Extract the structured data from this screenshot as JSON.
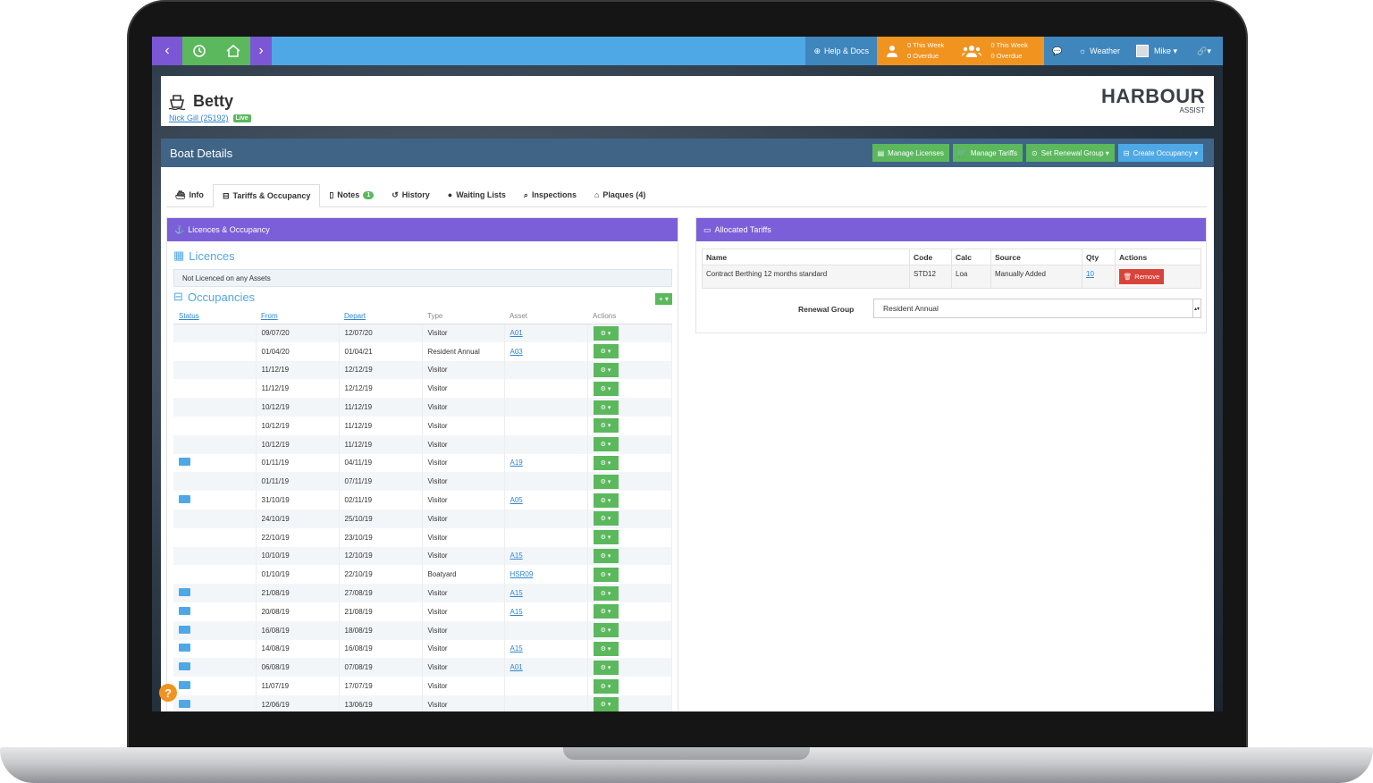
{
  "topbar": {
    "help_label": "Help & Docs",
    "stats_a": {
      "week": "0 This Week",
      "overdue": "0 Overdue"
    },
    "stats_b": {
      "week": "0 This Week",
      "overdue": "0 Overdue"
    },
    "weather_label": "Weather",
    "user_label": "Mike ▾"
  },
  "header": {
    "boat_name": "Betty",
    "owner_link": "Nick Gill (25192)",
    "status_badge": "Live",
    "logo_main": "HARBOUR",
    "logo_sub": "ASSIST"
  },
  "panel": {
    "title": "Boat Details",
    "buttons": {
      "manage_licenses": "Manage Licenses",
      "manage_tariffs": "Manage Tariffs",
      "set_renewal": "Set Renewal Group ▾",
      "create_occupancy": "Create Occupancy ▾"
    }
  },
  "tabs": {
    "info": "Info",
    "tariffs": "Tariffs & Occupancy",
    "notes": "Notes",
    "notes_count": "1",
    "history": "History",
    "waiting": "Waiting Lists",
    "inspections": "Inspections",
    "plaques": "Plaques (4)"
  },
  "left": {
    "card_title": "Licences & Occupancy",
    "licences_title": "Licences",
    "not_licenced": "Not Licenced on any Assets",
    "occupancies_title": "Occupancies",
    "columns": [
      "Status",
      "From",
      "Depart",
      "Type",
      "Asset",
      "Actions"
    ],
    "rows": [
      {
        "from": "09/07/20",
        "depart": "12/07/20",
        "type": "Visitor",
        "asset": "A01",
        "icon": false
      },
      {
        "from": "01/04/20",
        "depart": "01/04/21",
        "type": "Resident Annual",
        "asset": "A03",
        "icon": false
      },
      {
        "from": "11/12/19",
        "depart": "12/12/19",
        "type": "Visitor",
        "asset": "",
        "icon": false
      },
      {
        "from": "11/12/19",
        "depart": "12/12/19",
        "type": "Visitor",
        "asset": "",
        "icon": false
      },
      {
        "from": "10/12/19",
        "depart": "11/12/19",
        "type": "Visitor",
        "asset": "",
        "icon": false
      },
      {
        "from": "10/12/19",
        "depart": "11/12/19",
        "type": "Visitor",
        "asset": "",
        "icon": false
      },
      {
        "from": "10/12/19",
        "depart": "11/12/19",
        "type": "Visitor",
        "asset": "",
        "icon": false
      },
      {
        "from": "01/11/19",
        "depart": "04/11/19",
        "type": "Visitor",
        "asset": "A19",
        "icon": true
      },
      {
        "from": "01/11/19",
        "depart": "07/11/19",
        "type": "Visitor",
        "asset": "",
        "icon": false
      },
      {
        "from": "31/10/19",
        "depart": "02/11/19",
        "type": "Visitor",
        "asset": "A05",
        "icon": true
      },
      {
        "from": "24/10/19",
        "depart": "25/10/19",
        "type": "Visitor",
        "asset": "",
        "icon": false
      },
      {
        "from": "22/10/19",
        "depart": "23/10/19",
        "type": "Visitor",
        "asset": "",
        "icon": false
      },
      {
        "from": "10/10/19",
        "depart": "12/10/19",
        "type": "Visitor",
        "asset": "A15",
        "icon": false
      },
      {
        "from": "01/10/19",
        "depart": "22/10/19",
        "type": "Boatyard",
        "asset": "HSR09",
        "icon": false
      },
      {
        "from": "21/08/19",
        "depart": "27/08/19",
        "type": "Visitor",
        "asset": "A15",
        "icon": true
      },
      {
        "from": "20/08/19",
        "depart": "21/08/19",
        "type": "Visitor",
        "asset": "A15",
        "icon": true
      },
      {
        "from": "16/08/19",
        "depart": "18/08/19",
        "type": "Visitor",
        "asset": "",
        "icon": true
      },
      {
        "from": "14/08/19",
        "depart": "16/08/19",
        "type": "Visitor",
        "asset": "A15",
        "icon": true
      },
      {
        "from": "06/08/19",
        "depart": "07/08/19",
        "type": "Visitor",
        "asset": "A01",
        "icon": true
      },
      {
        "from": "11/07/19",
        "depart": "17/07/19",
        "type": "Visitor",
        "asset": "",
        "icon": true
      },
      {
        "from": "12/06/19",
        "depart": "13/06/19",
        "type": "Visitor",
        "asset": "",
        "icon": true
      }
    ]
  },
  "right": {
    "card_title": "Allocated Tariffs",
    "columns": [
      "Name",
      "Code",
      "Calc",
      "Source",
      "Qty",
      "Actions"
    ],
    "row": {
      "name": "Contract Berthing 12 months standard",
      "code": "STD12",
      "calc": "Loa",
      "source": "Manually Added",
      "qty": "10",
      "remove": "Remove"
    },
    "renewal_label": "Renewal Group",
    "renewal_value": "Resident Annual"
  },
  "help_fab": "?",
  "colors": {
    "purple": "#7b57d6",
    "green": "#5bb85d",
    "blue": "#4fa8e6",
    "orange": "#f0931f",
    "red": "#d9443a",
    "panel": "#3f6486"
  }
}
